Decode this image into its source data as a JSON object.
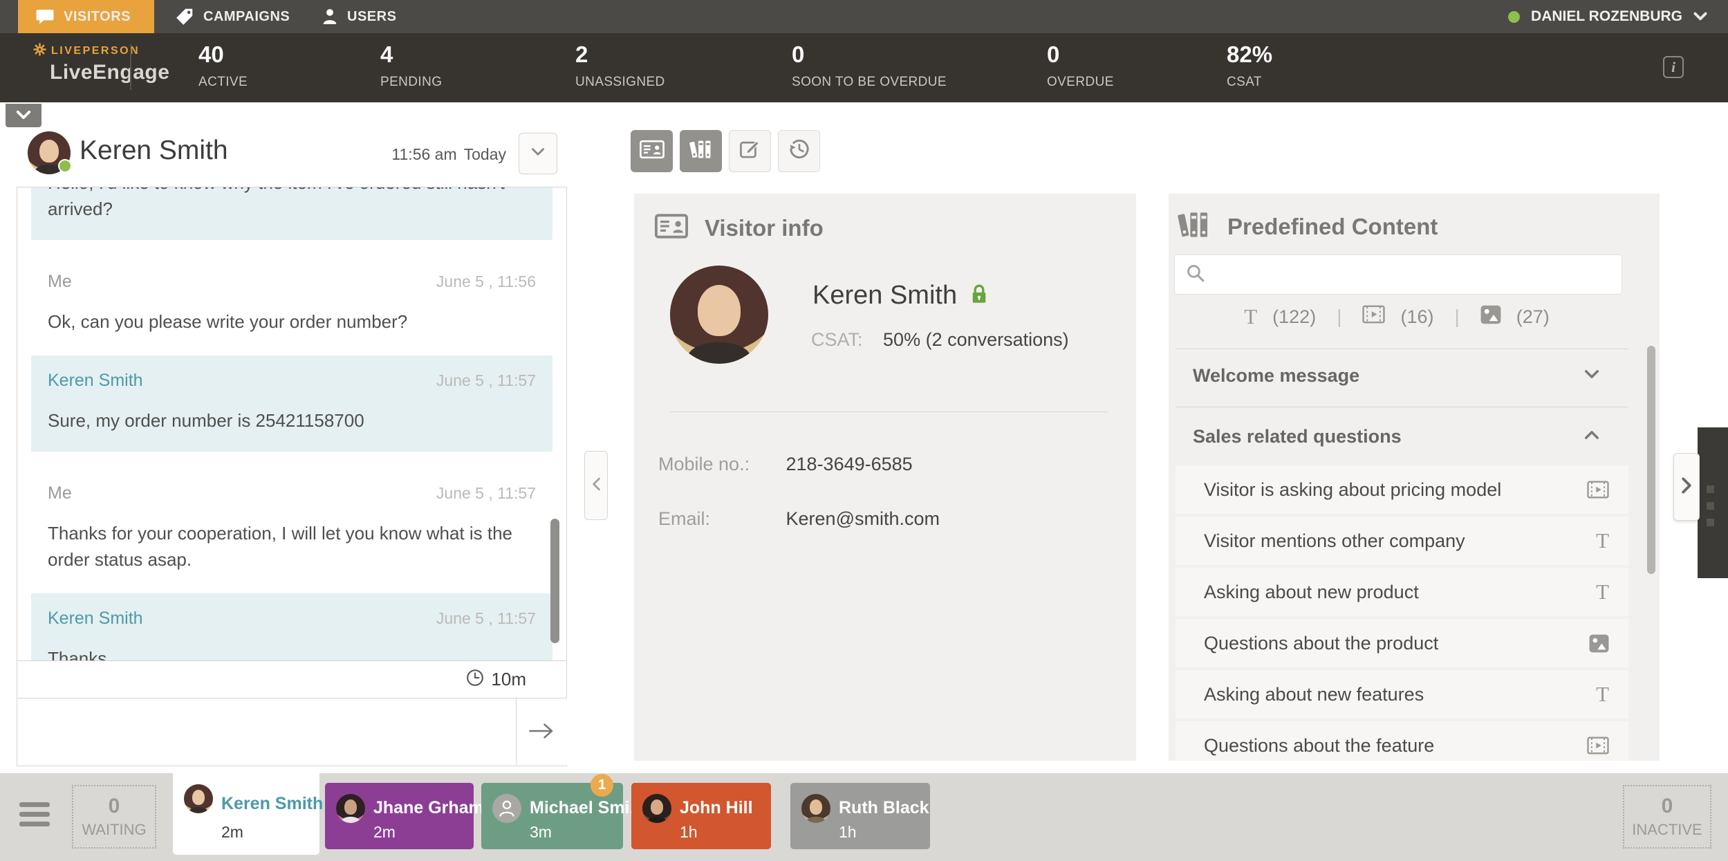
{
  "colors": {
    "accent_orange": "#E8A33C",
    "visitor_teal": "#4D9AA8",
    "bubble_teal": "#E4F0F2",
    "status_green": "#8CBF4C",
    "lock_green": "#6AA43E",
    "badge_orange": "#ECAA4F",
    "tab_purple": "#8C3E95",
    "tab_green": "#6D9E83",
    "tab_orange": "#D2562E",
    "tab_gray": "#9C9C9A",
    "tab_active": "#FFFFFF"
  },
  "topbar": {
    "tabs": [
      {
        "label": "VISITORS",
        "icon": "chat-bubble-icon",
        "active": true
      },
      {
        "label": "CAMPAIGNS",
        "icon": "tag-icon",
        "active": false
      },
      {
        "label": "USERS",
        "icon": "person-icon",
        "active": false
      }
    ],
    "user": {
      "name": "DANIEL ROZENBURG",
      "status": "online"
    }
  },
  "statsbar": {
    "brand": {
      "line1": "LIVEPERSON",
      "line2": "LiveEngage"
    },
    "stats": [
      {
        "value": "40",
        "label": "ACTIVE"
      },
      {
        "value": "4",
        "label": "PENDING"
      },
      {
        "value": "2",
        "label": "UNASSIGNED"
      },
      {
        "value": "0",
        "label": "SOON TO BE OVERDUE"
      },
      {
        "value": "0",
        "label": "OVERDUE"
      },
      {
        "value": "82%",
        "label": "CSAT"
      }
    ],
    "info_glyph": "i"
  },
  "chat": {
    "visitor_name": "Keren Smith",
    "time": "11:56 am",
    "day": "Today",
    "messages": [
      {
        "from": "visitor",
        "sender": "",
        "time": "",
        "body": "Hello, I'd like to know why the item I've ordered still hasn't arrived?"
      },
      {
        "from": "agent",
        "sender": "Me",
        "time": "June 5 , 11:56",
        "body": "Ok, can you please write your order number?"
      },
      {
        "from": "visitor",
        "sender": "Keren Smith",
        "time": "June 5 , 11:57",
        "body": "Sure, my order number is 25421158700"
      },
      {
        "from": "agent",
        "sender": "Me",
        "time": "June 5 , 11:57",
        "body": "Thanks for your cooperation, I will let you know what is the order status asap."
      },
      {
        "from": "visitor",
        "sender": "Keren Smith",
        "time": "June 5 , 11:57",
        "body": "Thanks."
      }
    ],
    "timer": "10m"
  },
  "toolbar": {
    "buttons": [
      {
        "icon": "visitor-info-card-icon",
        "active": true
      },
      {
        "icon": "predefined-content-icon",
        "active": true
      },
      {
        "icon": "compose-icon",
        "active": false
      },
      {
        "icon": "history-icon",
        "active": false
      }
    ]
  },
  "visitor_info": {
    "title": "Visitor info",
    "name": "Keren Smith",
    "csat_label": "CSAT:",
    "csat_value": "50% (2 conversations)",
    "fields": [
      {
        "label": "Mobile no.:",
        "value": "218-3649-6585"
      },
      {
        "label": "Email:",
        "value": "Keren@smith.com"
      }
    ]
  },
  "predefined": {
    "title": "Predefined Content",
    "search_value": "",
    "filters": [
      {
        "icon": "text-icon",
        "glyph": "T",
        "count": "(122)"
      },
      {
        "icon": "video-icon",
        "count": "(16)"
      },
      {
        "icon": "image-icon",
        "count": "(27)"
      }
    ],
    "sections": [
      {
        "label": "Welcome message",
        "expanded": false
      },
      {
        "label": "Sales related questions",
        "expanded": true
      }
    ],
    "items": [
      {
        "label": "Visitor is asking about pricing model",
        "icon": "video-icon"
      },
      {
        "label": "Visitor mentions other company",
        "icon": "text-icon",
        "glyph": "T"
      },
      {
        "label": "Asking about new product",
        "icon": "text-icon",
        "glyph": "T"
      },
      {
        "label": "Questions about the product",
        "icon": "image-icon"
      },
      {
        "label": "Asking about new features",
        "icon": "text-icon",
        "glyph": "T"
      },
      {
        "label": "Questions about the feature",
        "icon": "video-icon"
      }
    ]
  },
  "bottombar": {
    "waiting": {
      "count": "0",
      "label": "WAITING"
    },
    "inactive": {
      "count": "0",
      "label": "INACTIVE"
    },
    "tabs": [
      {
        "name": "Keren Smith",
        "time": "2m",
        "color": "#FFFFFF",
        "active": true
      },
      {
        "name": "Jhane Grham",
        "time": "2m",
        "color": "#8C3E95"
      },
      {
        "name": "Michael Smi..",
        "time": "3m",
        "color": "#6D9E83",
        "badge": "1"
      },
      {
        "name": "John Hill",
        "time": "1h",
        "color": "#D2562E"
      },
      {
        "name": "Ruth Black",
        "time": "1h",
        "color": "#9C9C9A"
      }
    ]
  }
}
